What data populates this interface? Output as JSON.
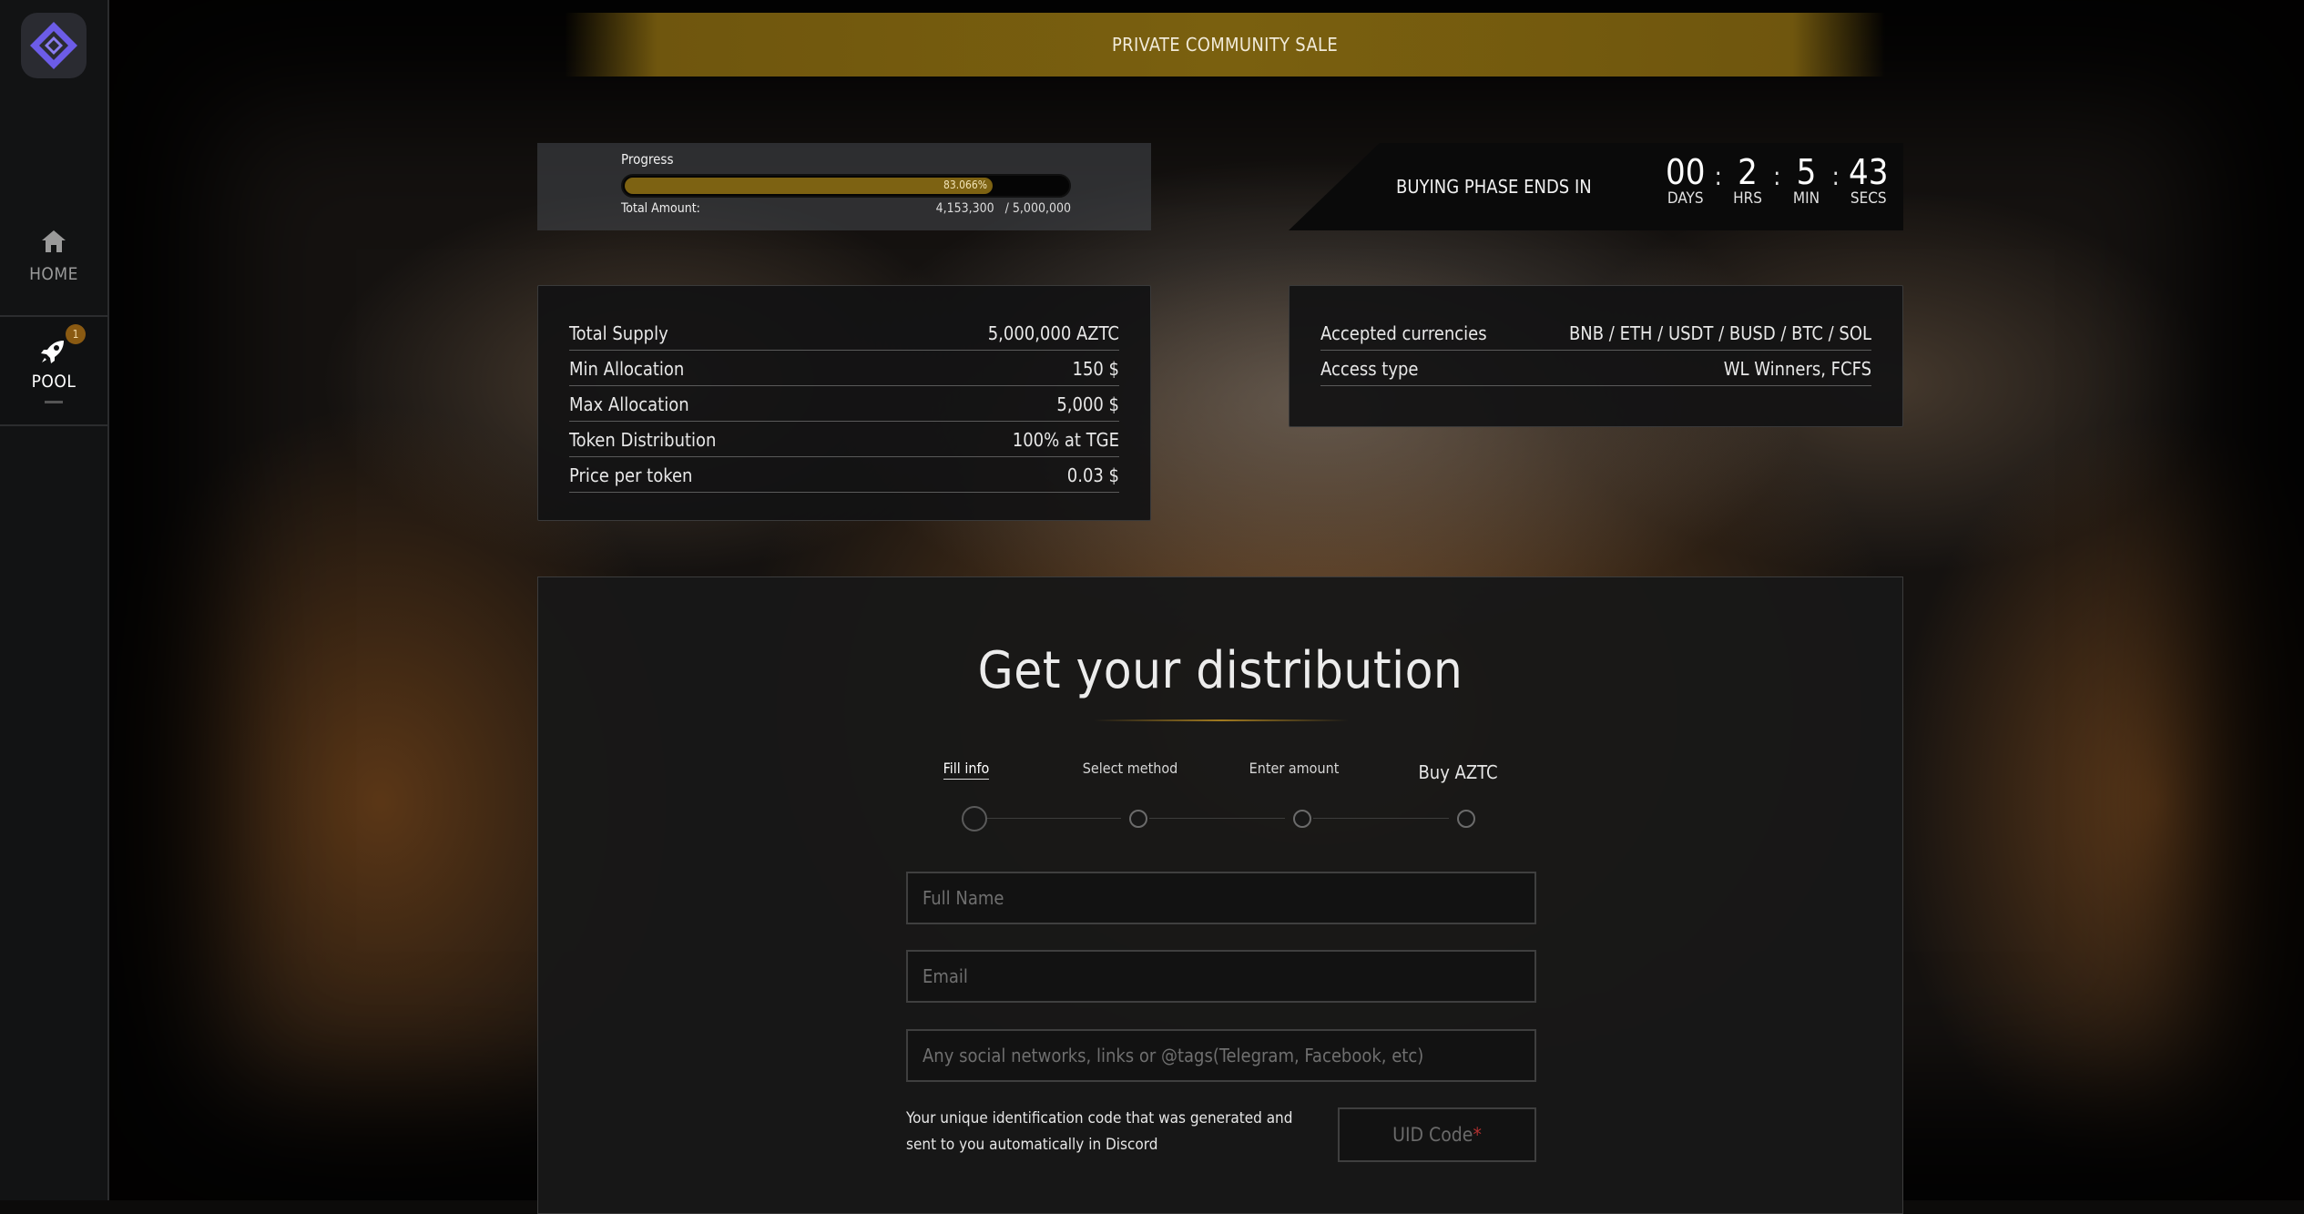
{
  "sidebar": {
    "logo_icon": "diamond-logo-icon",
    "items": [
      {
        "label": "HOME",
        "icon": "home-icon"
      },
      {
        "label": "POOL",
        "icon": "rocket-icon",
        "badge": "1"
      }
    ]
  },
  "banner": {
    "text": "PRIVATE COMMUNITY SALE"
  },
  "progress": {
    "label": "Progress",
    "percent_text": "83.066%",
    "percent": 83.066,
    "total_label": "Total Amount:",
    "raised": "4,153,300",
    "goal": "/ 5,000,000"
  },
  "countdown": {
    "title": "BUYING PHASE ENDS IN",
    "units": [
      {
        "value": "00",
        "label": "DAYS"
      },
      {
        "value": "2",
        "label": "HRS"
      },
      {
        "value": "5",
        "label": "MIN"
      },
      {
        "value": "43",
        "label": "SECS"
      }
    ],
    "separator": ":"
  },
  "token_info": [
    {
      "key": "Total Supply",
      "value": "5,000,000  AZTC"
    },
    {
      "key": "Min Allocation",
      "value": "150 $"
    },
    {
      "key": "Max Allocation",
      "value": "5,000 $"
    },
    {
      "key": "Token Distribution",
      "value": "100% at TGE"
    },
    {
      "key": "Price per token",
      "value": "0.03 $"
    }
  ],
  "sale_info": [
    {
      "key": "Accepted currencies",
      "value": "BNB / ETH / USDT / BUSD / BTC / SOL"
    },
    {
      "key": "Access type",
      "value": "WL Winners, FCFS"
    }
  ],
  "distribution": {
    "title": "Get your distribution",
    "steps": [
      "Fill info",
      "Select method",
      "Enter amount",
      "Buy AZTC"
    ],
    "fields": {
      "full_name_placeholder": "Full Name",
      "email_placeholder": "Email",
      "social_placeholder": "Any social networks, links or @tags(Telegram, Facebook, etc)"
    },
    "uid_description": "Your unique identification code that was generated and sent to you automatically in Discord",
    "uid_placeholder": "UID Code",
    "uid_required_mark": "*"
  },
  "colors": {
    "accent_gold": "#7d6212",
    "background": "#0c0b0a"
  }
}
